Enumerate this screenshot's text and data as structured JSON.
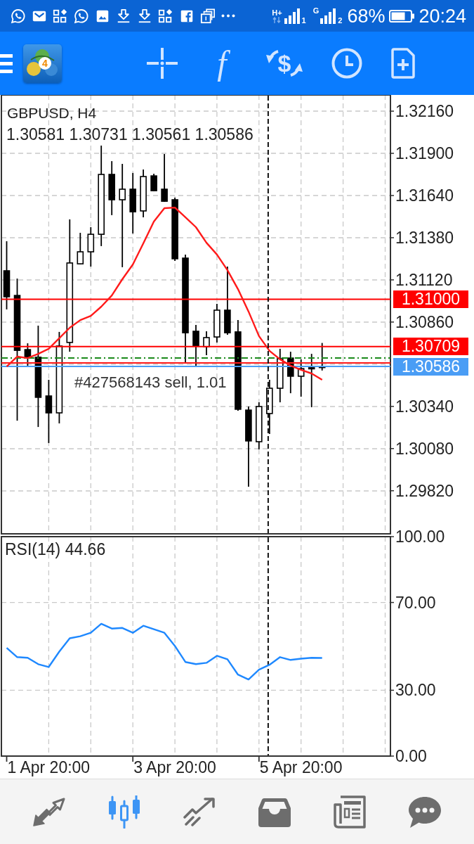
{
  "status_bar": {
    "network_1": "H+",
    "sim_1": "1",
    "network_2": "G",
    "sim_2": "2",
    "battery": "68%",
    "time": "20:24"
  },
  "toolbar": {
    "logo_badge": "4",
    "indicators": "f",
    "trade": "$"
  },
  "price_chart": {
    "ohlc_values": "1.30581 1.30731 1.30561 1.30586",
    "order_label": "#427568143 sell, 1.01",
    "chart_data": {
      "type": "candlestick",
      "title": "GBPUSD, H4",
      "categories": [
        null,
        null,
        null,
        null,
        null,
        null,
        null,
        null,
        null,
        null,
        null,
        null,
        null,
        null,
        null,
        null,
        null,
        null,
        null,
        null,
        null,
        null,
        null,
        null,
        null,
        null,
        null,
        null,
        null,
        null,
        null,
        null,
        null,
        null,
        null,
        null,
        null
      ],
      "ylim": [
        1.2955,
        1.3226
      ],
      "yticks": [
        {
          "value": 1.3216,
          "label": "1.32160"
        },
        {
          "value": 1.319,
          "label": "1.31900"
        },
        {
          "value": 1.3164,
          "label": "1.31640"
        },
        {
          "value": 1.3138,
          "label": "1.31380"
        },
        {
          "value": 1.3112,
          "label": "1.31120"
        },
        {
          "value": 1.3086,
          "label": "1.30860"
        },
        {
          "value": 1.3034,
          "label": "1.30340"
        },
        {
          "value": 1.3008,
          "label": "1.30080"
        },
        {
          "value": 1.2982,
          "label": "1.29820"
        }
      ],
      "grid": true,
      "ohlc": [
        [
          1.31176,
          1.31358,
          1.30938,
          1.31016
        ],
        [
          1.31024,
          1.31128,
          1.30252,
          1.30686
        ],
        [
          1.3069,
          1.30729,
          1.30582,
          1.30638
        ],
        [
          1.30643,
          1.30838,
          1.30213,
          1.30396
        ],
        [
          1.30404,
          1.30504,
          1.30114,
          1.303
        ],
        [
          1.303,
          1.30799,
          1.30235,
          1.30712
        ],
        [
          1.30734,
          1.31493,
          1.30677,
          1.31224
        ],
        [
          1.31219,
          1.3141,
          1.31215,
          1.31293
        ],
        [
          1.31293,
          1.31445,
          1.31202,
          1.31401
        ],
        [
          1.31401,
          1.31948,
          1.31328,
          1.3177
        ],
        [
          1.3177,
          1.31852,
          1.31519,
          1.31614
        ],
        [
          1.31614,
          1.31835,
          1.31198,
          1.31679
        ],
        [
          1.31679,
          1.31779,
          1.31406,
          1.3154
        ],
        [
          1.31545,
          1.318,
          1.31506,
          1.31757
        ],
        [
          1.31761,
          1.31774,
          1.31666,
          1.3167
        ],
        [
          1.31679,
          1.31896,
          1.31601,
          1.31605
        ],
        [
          1.31614,
          1.31627,
          1.31237,
          1.3125
        ],
        [
          1.31254,
          1.31276,
          1.30608,
          1.30794
        ],
        [
          1.30803,
          1.30842,
          1.30582,
          1.30712
        ],
        [
          1.30708,
          1.30803,
          1.30656,
          1.30764
        ],
        [
          1.30768,
          1.30972,
          1.30734,
          1.30933
        ],
        [
          1.30933,
          1.31202,
          1.30781,
          1.30794
        ],
        [
          1.30799,
          1.30872,
          1.30313,
          1.30322
        ],
        [
          1.30317,
          1.30339,
          1.29845,
          1.30127
        ],
        [
          1.30122,
          1.30365,
          1.30075,
          1.30339
        ],
        [
          1.30296,
          1.30504,
          1.3017,
          1.30452
        ],
        [
          1.30452,
          1.30695,
          1.30365,
          1.30634
        ],
        [
          1.30638,
          1.30677,
          1.30421,
          1.30526
        ],
        [
          1.30526,
          1.3063,
          1.304,
          1.30573
        ],
        [
          1.30573,
          1.30664,
          1.30335,
          1.30578
        ],
        [
          1.30581,
          1.30731,
          1.30561,
          1.30586
        ],
        null,
        null,
        null,
        null,
        null,
        null
      ],
      "series": [
        {
          "type": "line",
          "color": "#ff1a1a",
          "values": [
            1.30586,
            1.30647,
            1.30638,
            1.30664,
            1.30695,
            1.3076,
            1.30825,
            1.30872,
            1.30898,
            1.30955,
            1.31024,
            1.31124,
            1.31215,
            1.31345,
            1.3148,
            1.31562,
            1.31566,
            1.31506,
            1.31445,
            1.31349,
            1.31276,
            1.3118,
            1.31063,
            1.30925,
            1.30773,
            1.30682,
            1.3063,
            1.30591,
            1.30565,
            1.30543,
            1.30504,
            null,
            null,
            null,
            null,
            null,
            null
          ]
        }
      ],
      "ref_lines": [
        {
          "axis": "y",
          "value": 1.31,
          "label": "1.31000",
          "color": "#ff0000"
        },
        {
          "axis": "y",
          "value": 1.30709,
          "label": "1.30709",
          "color": "#ff0000"
        },
        {
          "axis": "y",
          "value": 1.30638,
          "color": "#1a8a1a"
        },
        {
          "axis": "y",
          "value": 1.30608,
          "color": "#ff1a1a"
        },
        {
          "axis": "y",
          "value": 1.30586,
          "label": "1.30586",
          "color": "#4a9df5"
        }
      ]
    }
  },
  "rsi_chart": {
    "chart_data": {
      "type": "line",
      "title": "RSI(14) 44.66",
      "categories": [
        null,
        null,
        null,
        null,
        null,
        null,
        null,
        null,
        null,
        null,
        null,
        null,
        null,
        null,
        null,
        null,
        null,
        null,
        null,
        null,
        null,
        null,
        null,
        null,
        null,
        null,
        null,
        null,
        null,
        null,
        null,
        null,
        null,
        null,
        null,
        null,
        null
      ],
      "ylim": [
        0,
        100
      ],
      "yticks": [
        {
          "value": 0,
          "label": "0.00"
        },
        {
          "value": 30,
          "label": "30.00"
        },
        {
          "value": 70,
          "label": "70.00"
        },
        {
          "value": 100,
          "label": "100.00"
        }
      ],
      "grid": true,
      "series": [
        {
          "color": "#1e88ff",
          "values": [
            49.3,
            45.1,
            44.8,
            41.9,
            40.6,
            47.6,
            53.7,
            54.6,
            56.2,
            60.3,
            58.1,
            58.4,
            56.2,
            59.4,
            57.8,
            56.2,
            50.2,
            42.9,
            41.9,
            42.5,
            45.7,
            44.1,
            37.1,
            34.9,
            39.4,
            41.6,
            45.1,
            43.8,
            44.4,
            44.8,
            44.7,
            null,
            null,
            null,
            null,
            null,
            null
          ]
        }
      ]
    }
  },
  "time_axis": [
    "1 Apr 20:00",
    "3 Apr 20:00",
    "5 Apr 20:00"
  ],
  "bottom_nav": [
    {
      "selected": false
    },
    {
      "selected": true
    },
    {
      "selected": false
    },
    {
      "selected": false
    },
    {
      "selected": false
    },
    {
      "selected": false
    }
  ]
}
